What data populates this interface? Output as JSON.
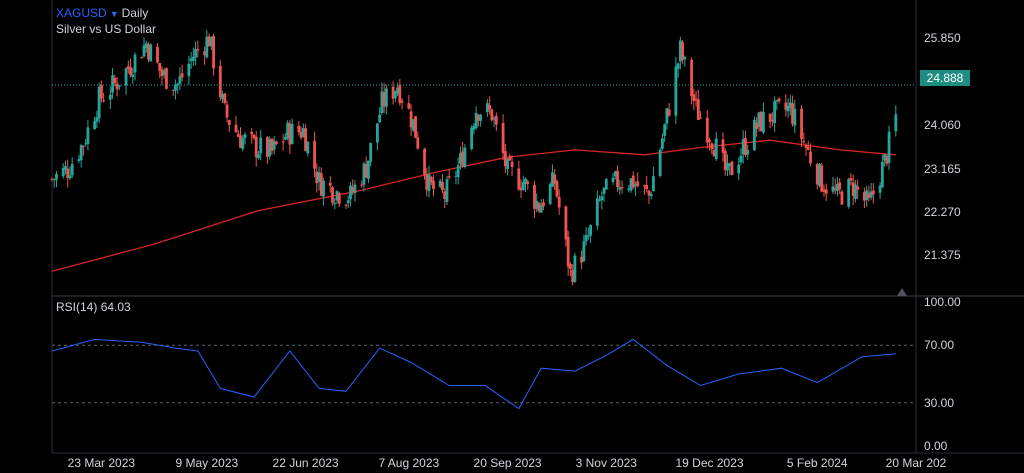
{
  "header": {
    "symbol": "XAGUSD",
    "interval": "Daily",
    "description": "Silver vs US Dollar",
    "last_price": "24.888"
  },
  "rsi_header": {
    "label": "RSI(14)",
    "value": "64.03"
  },
  "colors": {
    "background": "#000000",
    "up": "#26a69a",
    "down": "#ef5350",
    "ma": "#d62525",
    "rsi": "#2962ff",
    "accent": "#2962ff",
    "last_price_bg": "#1e8c80"
  },
  "icons": [
    "dropdown-caret-icon",
    "scroll-triangle-icon"
  ],
  "chart_data": [
    {
      "type": "candlestick",
      "title": "XAGUSD Daily — Silver vs US Dollar",
      "y_ticks": [
        "25.850",
        "24.060",
        "23.165",
        "22.270",
        "21.375"
      ],
      "x_ticks": [
        "23 Mar 2023",
        "9 May 2023",
        "22 Jun 2023",
        "7 Aug 2023",
        "20 Sep 2023",
        "3 Nov 2023",
        "19 Dec 2023",
        "5 Feb 2024",
        "20 Mar 202"
      ],
      "ylim": [
        20.6,
        26.6
      ],
      "x_range": [
        "2023-03-01",
        "2024-03-20"
      ],
      "last_price": 24.888,
      "grid": false,
      "close_series": {
        "x": [
          "2023-03-01",
          "2023-03-08",
          "2023-03-15",
          "2023-03-22",
          "2023-03-29",
          "2023-04-05",
          "2023-04-12",
          "2023-04-19",
          "2023-04-26",
          "2023-05-03",
          "2023-05-10",
          "2023-05-17",
          "2023-05-24",
          "2023-05-31",
          "2023-06-07",
          "2023-06-14",
          "2023-06-21",
          "2023-06-28",
          "2023-07-05",
          "2023-07-12",
          "2023-07-19",
          "2023-07-26",
          "2023-08-02",
          "2023-08-09",
          "2023-08-16",
          "2023-08-23",
          "2023-08-30",
          "2023-09-06",
          "2023-09-13",
          "2023-09-20",
          "2023-09-27",
          "2023-10-04",
          "2023-10-11",
          "2023-10-18",
          "2023-10-25",
          "2023-11-01",
          "2023-11-08",
          "2023-11-15",
          "2023-11-22",
          "2023-11-29",
          "2023-12-06",
          "2023-12-13",
          "2023-12-20",
          "2023-12-27",
          "2024-01-03",
          "2024-01-10",
          "2024-01-17",
          "2024-01-24",
          "2024-01-31",
          "2024-02-07",
          "2024-02-14",
          "2024-02-21",
          "2024-02-28",
          "2024-03-06",
          "2024-03-11"
        ],
        "values": [
          22.95,
          23.15,
          23.7,
          24.6,
          24.9,
          25.3,
          25.75,
          25.1,
          24.9,
          25.5,
          25.85,
          24.3,
          23.8,
          23.6,
          23.5,
          23.9,
          23.95,
          22.9,
          22.7,
          22.6,
          23.2,
          24.5,
          24.9,
          24.1,
          22.8,
          22.6,
          23.3,
          24.4,
          24.3,
          23.1,
          22.9,
          22.4,
          22.9,
          21.0,
          21.6,
          22.6,
          22.9,
          22.9,
          22.6,
          24.0,
          25.6,
          24.4,
          23.8,
          23.0,
          23.6,
          24.1,
          24.3,
          24.4,
          23.6,
          22.9,
          22.6,
          22.8,
          22.4,
          23.3,
          24.2,
          24.9,
          24.888
        ]
      },
      "moving_average": {
        "name": "",
        "x": [
          "2023-03-01",
          "2023-04-15",
          "2023-06-01",
          "2023-07-15",
          "2023-08-20",
          "2023-09-20",
          "2023-10-20",
          "2023-11-20",
          "2023-12-15",
          "2024-01-15",
          "2024-02-15",
          "2024-03-11"
        ],
        "values": [
          21.05,
          21.6,
          22.3,
          22.7,
          23.1,
          23.4,
          23.55,
          23.45,
          23.6,
          23.75,
          23.55,
          23.45
        ]
      }
    },
    {
      "type": "line",
      "title": "RSI(14) 64.03",
      "y_ticks": [
        "100.00",
        "70.00",
        "30.00",
        "0.00"
      ],
      "ylim": [
        0,
        100
      ],
      "reference_lines": [
        70,
        30
      ],
      "x": [
        "2023-03-01",
        "2023-03-20",
        "2023-04-10",
        "2023-04-25",
        "2023-05-05",
        "2023-05-15",
        "2023-05-30",
        "2023-06-15",
        "2023-06-28",
        "2023-07-10",
        "2023-07-25",
        "2023-08-08",
        "2023-08-25",
        "2023-09-10",
        "2023-09-25",
        "2023-10-05",
        "2023-10-20",
        "2023-11-03",
        "2023-11-15",
        "2023-11-30",
        "2023-12-15",
        "2024-01-01",
        "2024-01-20",
        "2024-02-05",
        "2024-02-25",
        "2024-03-11"
      ],
      "values": [
        66,
        74,
        72,
        68,
        66,
        40,
        34,
        66,
        40,
        38,
        68,
        58,
        42,
        42,
        26,
        54,
        52,
        63,
        74,
        56,
        42,
        50,
        54,
        44,
        62,
        64.03
      ]
    }
  ]
}
